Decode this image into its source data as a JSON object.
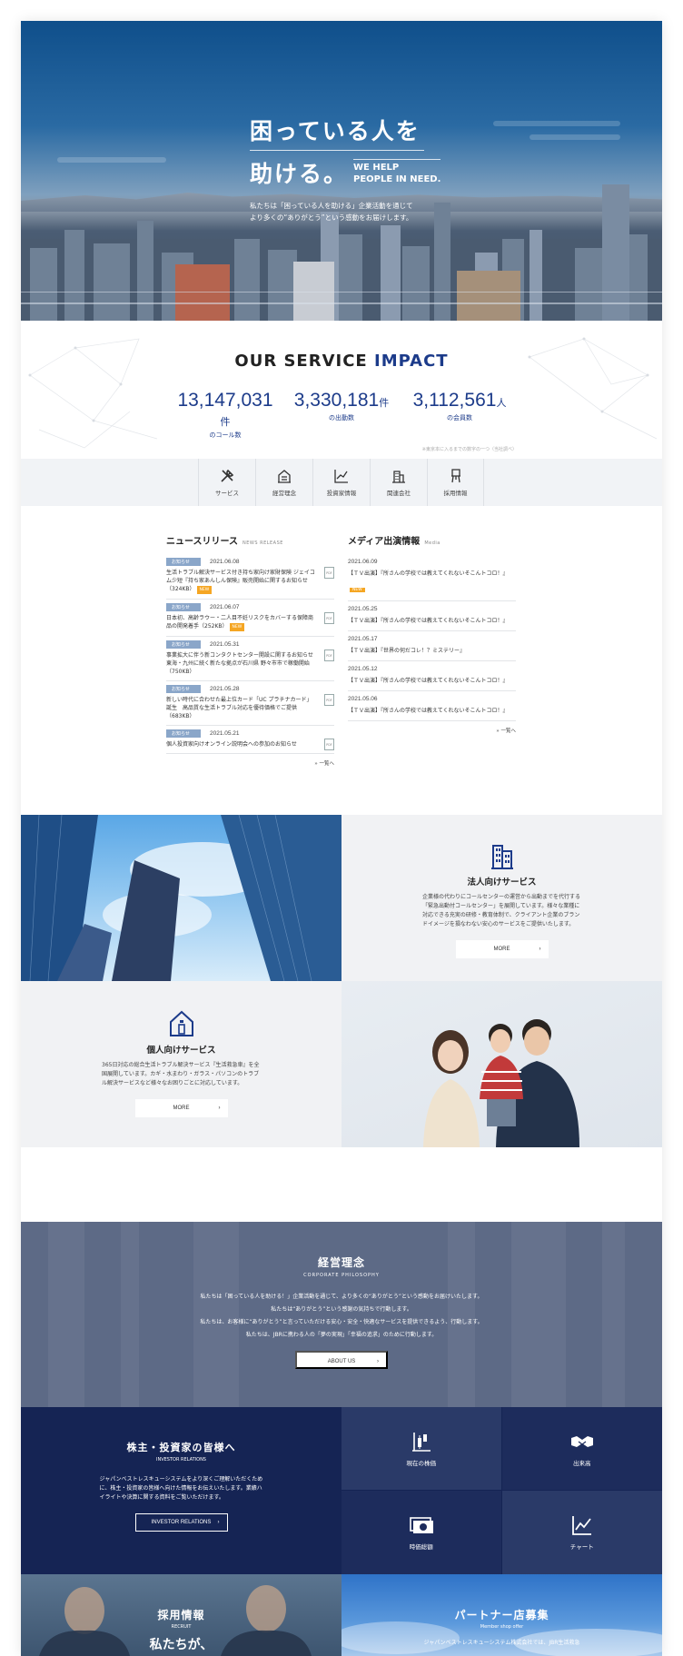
{
  "hero": {
    "title_line1": "困っている人を",
    "title_line2": "助ける。",
    "title_en_line1": "WE HELP",
    "title_en_line2": "PEOPLE IN NEED.",
    "description_line1": "私たちは「困っている人を助ける」企業活動を通じて",
    "description_line2": "より多くの“ありがとう”という感動をお届けします。"
  },
  "impact": {
    "title_prefix": "OUR SERVICE ",
    "title_accent": "IMPACT",
    "stats": [
      {
        "value": "13,147,031",
        "unit": "件",
        "label": "のコール数"
      },
      {
        "value": "3,330,181",
        "unit": "件",
        "label": "の出動数"
      },
      {
        "value": "3,112,561",
        "unit": "人",
        "label": "の会員数"
      }
    ],
    "note": "※東京本に入るまでの数字の一つ（当社調べ）"
  },
  "nav": {
    "items": [
      {
        "label": "サービス",
        "icon": "tools-icon"
      },
      {
        "label": "経営理念",
        "icon": "building-icon"
      },
      {
        "label": "投資家情報",
        "icon": "chart-icon"
      },
      {
        "label": "関連会社",
        "icon": "office-icon"
      },
      {
        "label": "採用情報",
        "icon": "chair-icon"
      }
    ]
  },
  "news": {
    "title": "ニュースリリース",
    "subtitle": "NEWS RELEASE",
    "more": "» 一覧へ",
    "pdf_label": "PDF",
    "new_label": "NEW",
    "items": [
      {
        "badge": "お知らせ",
        "date": "2021.06.08",
        "text": "生活トラブル解決サービス付き持ち家向け家財保険 ジェイコム少短『持ち家あんしん保険』販売開始に関するお知らせ（324KB）",
        "new": true
      },
      {
        "badge": "お知らせ",
        "date": "2021.06.07",
        "text": "日本初、高齢ラウー・二人目不妊リスクをカバーする保障商品の開発着手（252KB）",
        "new": true
      },
      {
        "badge": "お知らせ",
        "date": "2021.05.31",
        "text": "事業拡大に伴う新コンタクトセンター開設に関するお知らせ 東海・九州に続く新たな拠点が石川県 野々市市で稼働開始（750KB）",
        "new": false
      },
      {
        "badge": "お知らせ",
        "date": "2021.05.28",
        "text": "新しい時代に合わせた最上位カード「UC プラチナカード」誕生　高品質な生活トラブル対応を優待価格でご提供（683KB）",
        "new": false
      },
      {
        "badge": "お知らせ",
        "date": "2021.05.21",
        "text": "個人投資家向けオンライン説明会への参加のお知らせ",
        "new": false
      }
    ]
  },
  "media": {
    "title": "メディア出演情報",
    "subtitle": "Media",
    "more": "» 一覧へ",
    "new_label": "NEW",
    "items": [
      {
        "date": "2021.06.09",
        "text": "【ＴＶ出演】『所さんの学校では教えてくれないそこんトコロ！』",
        "new": true
      },
      {
        "date": "2021.05.25",
        "text": "【ＴＶ出演】『所さんの学校では教えてくれないそこんトコロ！』",
        "new": false
      },
      {
        "date": "2021.05.17",
        "text": "【ＴＶ出演】『世界の何だコレ！？ミステリー』",
        "new": false
      },
      {
        "date": "2021.05.12",
        "text": "【ＴＶ出演】『所さんの学校では教えてくれないそこんトコロ！』",
        "new": false
      },
      {
        "date": "2021.05.06",
        "text": "【ＴＶ出演】『所さんの学校では教えてくれないそこんトコロ！』",
        "new": false
      }
    ]
  },
  "services": {
    "corporate": {
      "title": "法人向けサービス",
      "description": "企業様の代わりにコールセンターの運営から出動までを代行する「緊急出動付コールセンター」を展開しています。様々な業種に対応できる充実の研修・教育体制で、クライアント企業のブランドイメージを損なわない安心のサービスをご提供いたします。",
      "button": "MORE"
    },
    "personal": {
      "title": "個人向けサービス",
      "description": "365日対応の総合生活トラブル解決サービス『生活救急車』を全国展開しています。カギ・水まわり・ガラス・パソコンのトラブル解決サービスなど様々なお困りごとに対応しています。",
      "button": "MORE"
    }
  },
  "philosophy": {
    "title": "経営理念",
    "subtitle": "CORPORATE PHILOSOPHY",
    "lines": [
      "私たちは「困っている人を助ける！」企業活動を通じて、より多くの“ありがとう”という感動をお届けいたします。",
      "私たちは“ありがとう”という感謝の気持ちで行動します。",
      "私たちは、お客様に“ありがとう”と言っていただける安心・安全・快適なサービスを提供できるよう、行動します。",
      "私たちは、JBRに携わる人の「夢の実現」「幸福の追求」のために行動します。"
    ],
    "button": "ABOUT US"
  },
  "ir": {
    "title": "株主・投資家の皆様へ",
    "subtitle": "INVESTOR RELATIONS",
    "description": "ジャパンベストレスキューシステムをより深くご理解いただくために、株主・投資家の皆様へ向けた情報をお伝えいたします。業績ハイライトや決算に関する資料をご覧いただけます。",
    "button": "INVESTOR RELATIONS",
    "links": [
      {
        "label": "現在の株価",
        "icon": "stock-price-icon"
      },
      {
        "label": "出来高",
        "icon": "handshake-icon"
      },
      {
        "label": "時価総額",
        "icon": "money-icon"
      },
      {
        "label": "チャート",
        "icon": "line-chart-icon"
      }
    ]
  },
  "recruit": {
    "title": "採用情報",
    "subtitle": "RECRUIT",
    "catch": "私たちが、"
  },
  "partner": {
    "title": "パートナー店募集",
    "subtitle": "Member shop offer",
    "description": "ジャパンベストレスキューシステム株式会社では、JBR生活救急"
  },
  "colors": {
    "accent": "#1c3b8a",
    "navy": "#152454",
    "orange": "#f5a623",
    "badge": "#8aa6c9"
  }
}
